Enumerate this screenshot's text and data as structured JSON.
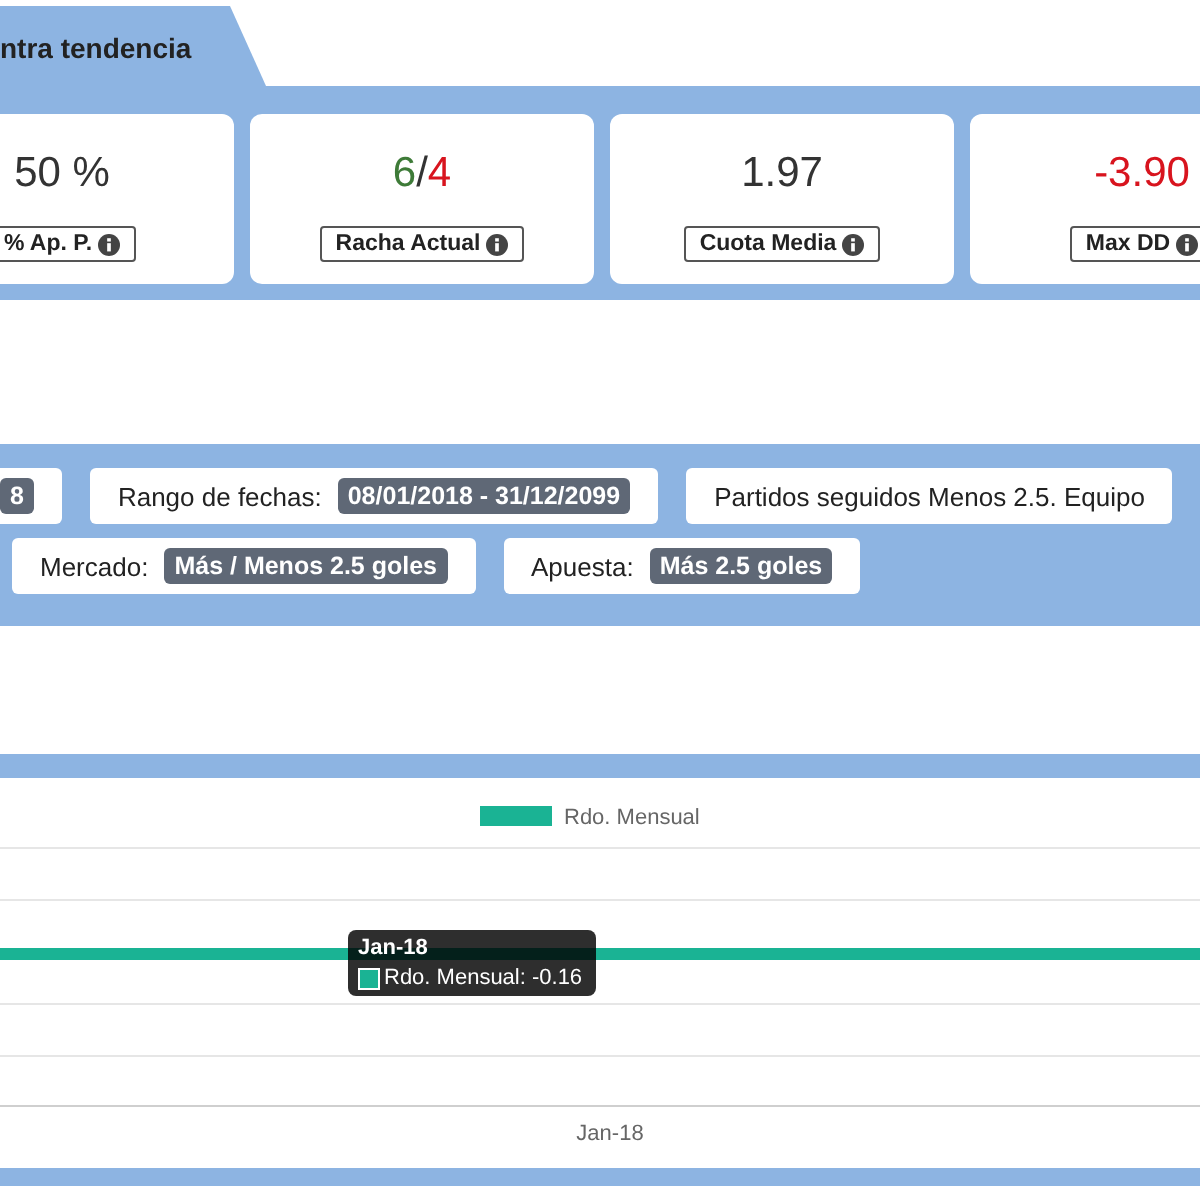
{
  "tab": {
    "label": "ntra tendencia"
  },
  "stats": [
    {
      "parts": [
        {
          "text": "50 %",
          "color": "#333333"
        }
      ],
      "label": "% Ap. P."
    },
    {
      "parts": [
        {
          "text": "6",
          "color": "#3e7b38"
        },
        {
          "text": "/",
          "color": "#333333"
        },
        {
          "text": "4",
          "color": "#d8141e"
        }
      ],
      "label": "Racha Actual"
    },
    {
      "parts": [
        {
          "text": "1.97",
          "color": "#333333"
        }
      ],
      "label": "Cuota Media"
    },
    {
      "parts": [
        {
          "text": "-3.90",
          "color": "#d8141e"
        }
      ],
      "label": "Max DD"
    }
  ],
  "filters": [
    [
      {
        "value": "8"
      },
      {
        "label": "Rango de fechas:",
        "value": "08/01/2018 - 31/12/2099"
      },
      {
        "label": "Partidos seguidos Menos 2.5. Equipo"
      }
    ],
    [
      {
        "label": "Mercado:",
        "value": "Más / Menos 2.5 goles"
      },
      {
        "label": "Apuesta:",
        "value": "Más 2.5 goles"
      }
    ]
  ],
  "chart": {
    "legend": [
      {
        "label": "Rdo. Mensual",
        "color": "#1ab394"
      }
    ],
    "x_labels": [
      "Jan-18"
    ],
    "tooltip": {
      "title": "Jan-18",
      "text": "Rdo. Mensual: -0.16"
    }
  }
}
